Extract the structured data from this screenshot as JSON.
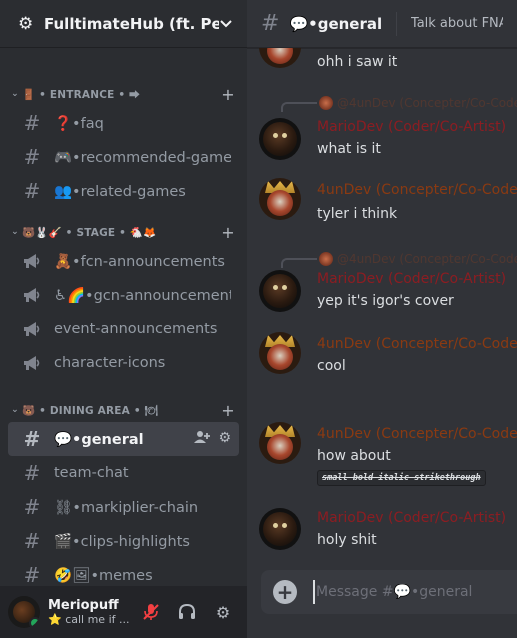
{
  "server": {
    "name": "FulltimateHub (ft. Pe..."
  },
  "categories": [
    {
      "label": "🚪 • ENTRANCE • ⮕"
    },
    {
      "label": "🐻🐰🎸 • STAGE • 🐔🦊"
    },
    {
      "label": "🐻 • DINING AREA • 🍽"
    }
  ],
  "channels": {
    "entrance": [
      {
        "label": "❓•faq"
      },
      {
        "label": "🎮•recommended-games"
      },
      {
        "label": "👥•related-games"
      }
    ],
    "stage": [
      {
        "label": "🧸•fcn-announcements"
      },
      {
        "label": "♿🌈•gcn-announcements"
      },
      {
        "label": "event-announcements"
      },
      {
        "label": "character-icons"
      }
    ],
    "dining": [
      {
        "label": "💬•general"
      },
      {
        "label": "team-chat"
      },
      {
        "label": "⛓•markiplier-chain"
      },
      {
        "label": "🎬•clips-highlights"
      },
      {
        "label": "🤣🖼•memes"
      }
    ]
  },
  "user": {
    "name": "Meriopuff",
    "status": "⭐ call me if ..."
  },
  "header": {
    "title": "💬•general",
    "topic": "Talk about FNAF st"
  },
  "messages": [
    {
      "text": "ohh i saw it"
    },
    {
      "reply": "@4unDev (Concepter/Co-Code",
      "author": "MarioDev (Coder/Co-Artist)",
      "text": "what is it"
    },
    {
      "author": "4unDev (Concepter/Co-Code",
      "text": "tyler i think"
    },
    {
      "reply": "@4unDev (Concepter/Co-Code",
      "author": "MarioDev (Coder/Co-Artist)",
      "text": "yep it's igor's cover"
    },
    {
      "author": "4unDev (Concepter/Co-Code",
      "text": "cool"
    },
    {
      "author": "4unDev (Concepter/Co-Code",
      "text": "how about",
      "code": "small bold italic strikethrough"
    },
    {
      "author": "MarioDev (Coder/Co-Artist)",
      "text": "holy shit"
    }
  ],
  "composer": {
    "placeholder": "Message #💬•general"
  },
  "colors": {
    "sidebar": "#2b2d31",
    "main": "#313338",
    "mario_role": "#8c1d22",
    "foun_role": "#8a3a12",
    "online": "#23a55a",
    "muted": "#f23f42"
  }
}
